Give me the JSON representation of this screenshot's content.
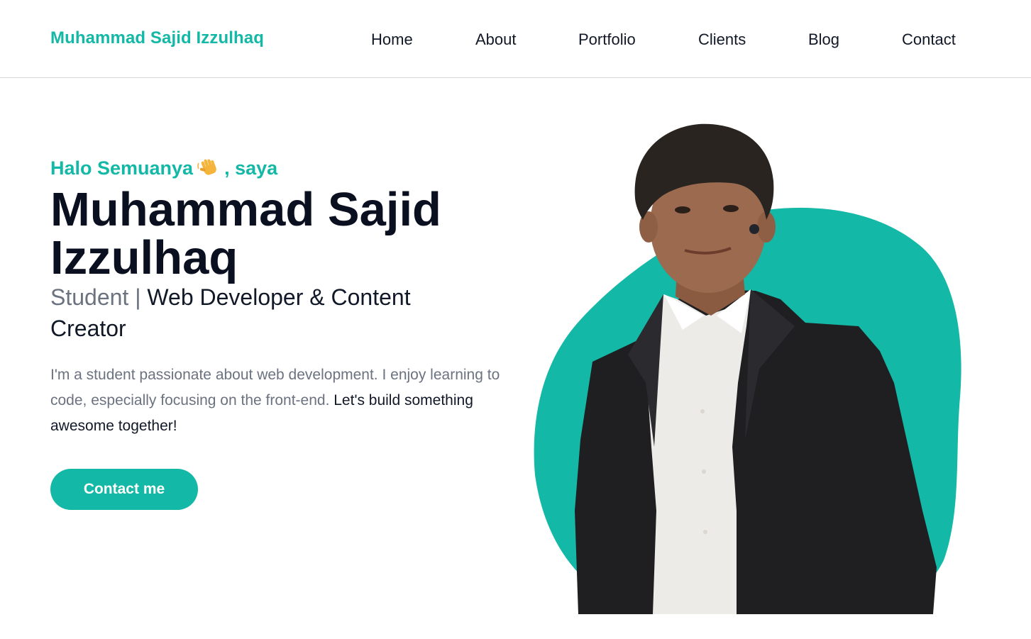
{
  "header": {
    "brand": "Muhammad Sajid Izzulhaq",
    "nav": {
      "home": "Home",
      "about": "About",
      "portfolio": "Portfolio",
      "clients": "Clients",
      "blog": "Blog",
      "contact": "Contact"
    }
  },
  "hero": {
    "greeting_prefix": "Halo Semuanya",
    "greeting_icon": "waving-hand-icon",
    "greeting_suffix": ", saya",
    "name_line1": "Muhammad Sajid",
    "name_line2": "Izzulhaq",
    "role_student": "Student | ",
    "role_rest": "Web Developer & Content Creator",
    "description_muted": "I'm a student passionate about web development. I enjoy learning to code, especially focusing on the front-end. ",
    "description_dark": "Let's build something awesome together!",
    "cta_label": "Contact me",
    "image": "portrait-photo"
  },
  "colors": {
    "accent": "#14b8a6",
    "heading": "#0b1020",
    "muted": "#6b7280",
    "border": "#d6d6d6"
  }
}
